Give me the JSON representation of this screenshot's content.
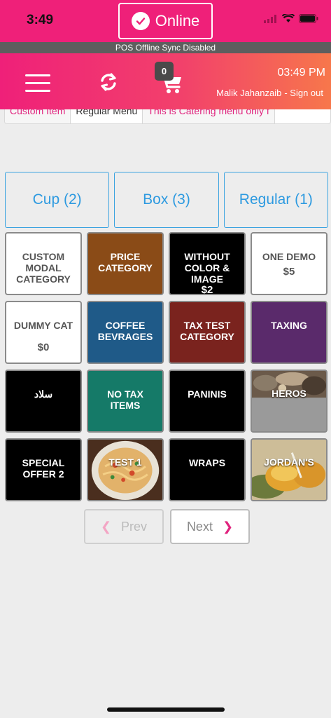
{
  "status_bar": {
    "time": "3:49"
  },
  "connection": {
    "label": "Online"
  },
  "sync_notice": "POS Offline Sync Disabled",
  "header": {
    "cart_count": "0",
    "clock": "03:49 PM",
    "user_name": "Malik Jahanzaib",
    "sign_out": "- Sign out"
  },
  "menu_tabs": [
    {
      "label": "Custom Item",
      "active": false
    },
    {
      "label": "Regular Menu",
      "active": true
    },
    {
      "label": "This is Catering menu only f",
      "active": false
    }
  ],
  "sub_categories": [
    {
      "label": "Cup (2)"
    },
    {
      "label": "Box (3)"
    },
    {
      "label": "Regular (1)"
    }
  ],
  "categories": [
    {
      "name": "CUSTOM MODAL CATEGORY",
      "price": "",
      "style": "white"
    },
    {
      "name": "PRICE CATEGORY",
      "price": "",
      "style": "brown"
    },
    {
      "name": "WITHOUT COLOR & IMAGE",
      "price": "$2",
      "style": "black"
    },
    {
      "name": "ONE DEMO",
      "price": "$5",
      "style": "white"
    },
    {
      "name": "DUMMY CAT",
      "price": "$0",
      "style": "white"
    },
    {
      "name": "COFFEE BEVRAGES",
      "price": "",
      "style": "blue"
    },
    {
      "name": "TAX TEST CATEGORY",
      "price": "",
      "style": "maroon"
    },
    {
      "name": "TAXING",
      "price": "",
      "style": "purple"
    },
    {
      "name": "سلاد",
      "price": "",
      "style": "black"
    },
    {
      "name": "NO TAX ITEMS",
      "price": "",
      "style": "green"
    },
    {
      "name": "PANINIS",
      "price": "",
      "style": "black"
    },
    {
      "name": "HEROS",
      "price": "",
      "style": "photo-heros"
    },
    {
      "name": "SPECIAL OFFER 2",
      "price": "",
      "style": "black"
    },
    {
      "name": "TEST 1",
      "price": "",
      "style": "photo-pasta"
    },
    {
      "name": "WRAPS",
      "price": "",
      "style": "black"
    },
    {
      "name": "JORDAN'S",
      "price": "",
      "style": "photo-jordans"
    }
  ],
  "pagination": {
    "prev": "Prev",
    "next": "Next"
  },
  "colors": {
    "brand_pink": "#ef2079",
    "gradient_end": "#f7774b",
    "link_blue": "#2d9ae0"
  }
}
